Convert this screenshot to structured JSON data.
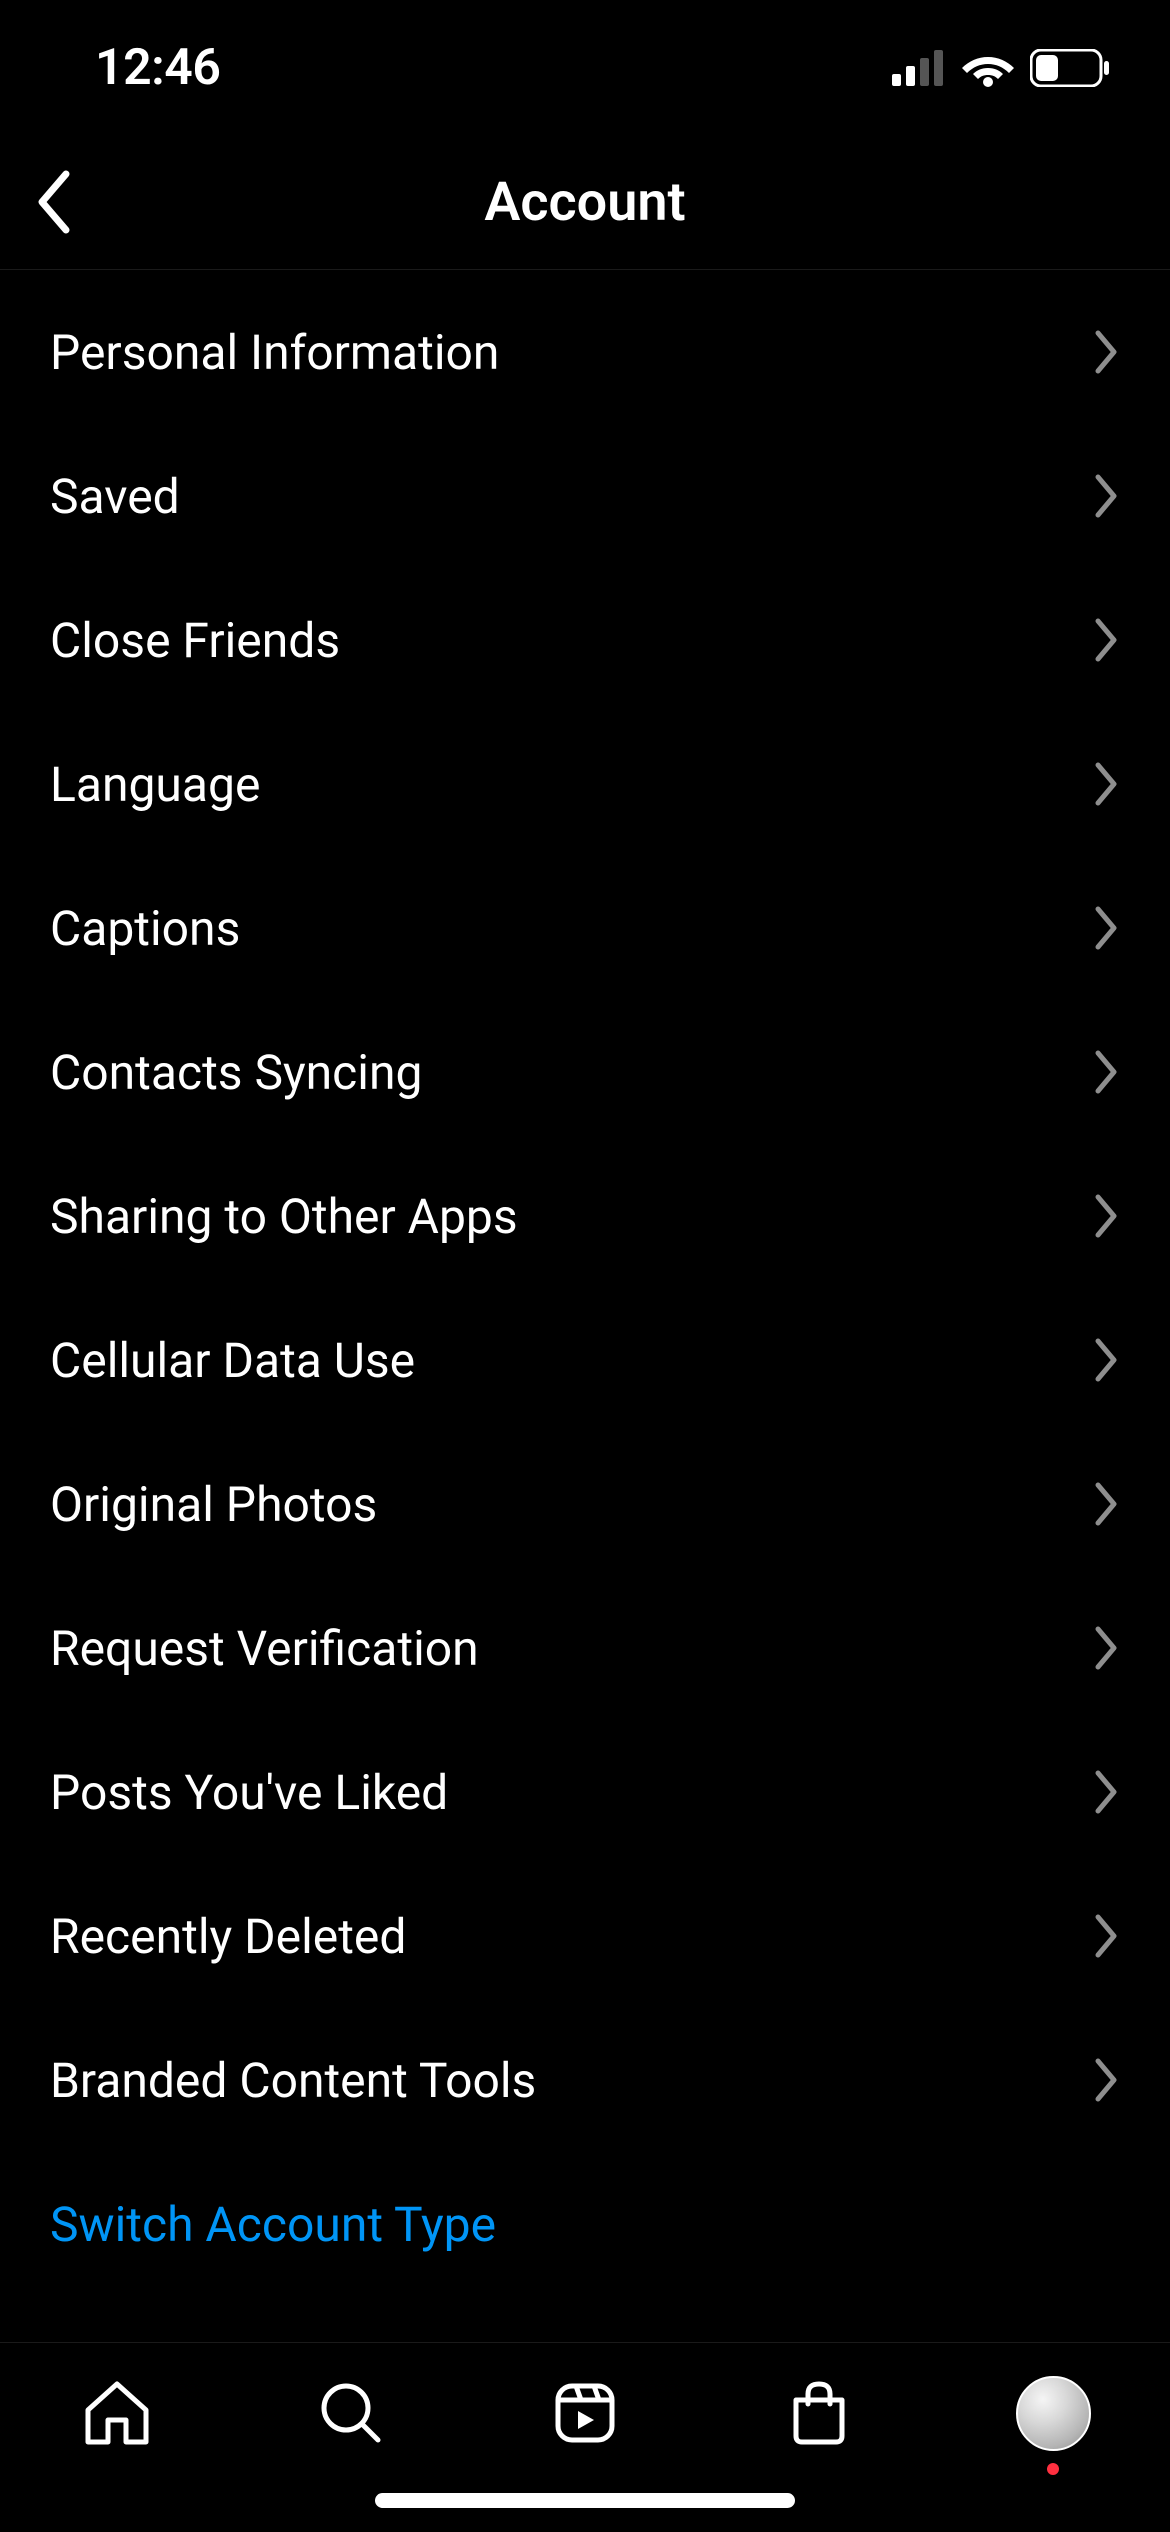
{
  "status_bar": {
    "time": "12:46"
  },
  "header": {
    "title": "Account"
  },
  "settings": {
    "items": [
      {
        "label": "Personal Information"
      },
      {
        "label": "Saved"
      },
      {
        "label": "Close Friends"
      },
      {
        "label": "Language"
      },
      {
        "label": "Captions"
      },
      {
        "label": "Contacts Syncing"
      },
      {
        "label": "Sharing to Other Apps"
      },
      {
        "label": "Cellular Data Use"
      },
      {
        "label": "Original Photos"
      },
      {
        "label": "Request Verification"
      },
      {
        "label": "Posts You've Liked"
      },
      {
        "label": "Recently Deleted"
      },
      {
        "label": "Branded Content Tools"
      }
    ],
    "accent_action": "Switch Account Type"
  }
}
